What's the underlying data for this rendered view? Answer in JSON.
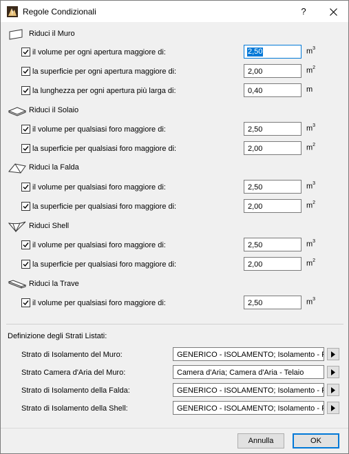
{
  "window": {
    "title": "Regole Condizionali",
    "help_label": "?",
    "close_icon": "close-icon"
  },
  "sections": {
    "muro": {
      "title": "Riduci il Muro",
      "icon": "wall-icon",
      "rows": [
        {
          "label": "il volume per ogni apertura maggiore di:",
          "value": "2,50",
          "unit": "m",
          "sup": "3",
          "checked": true
        },
        {
          "label": "la superficie per ogni apertura maggiore di:",
          "value": "2,00",
          "unit": "m",
          "sup": "2",
          "checked": true
        },
        {
          "label": "la lunghezza per ogni apertura più larga di:",
          "value": "0,40",
          "unit": "m",
          "sup": "",
          "checked": true
        }
      ]
    },
    "solaio": {
      "title": "Riduci il Solaio",
      "icon": "slab-icon",
      "rows": [
        {
          "label": "il volume per qualsiasi foro maggiore di:",
          "value": "2,50",
          "unit": "m",
          "sup": "3",
          "checked": true
        },
        {
          "label": "la superficie per qualsiasi foro maggiore di:",
          "value": "2,00",
          "unit": "m",
          "sup": "2",
          "checked": true
        }
      ]
    },
    "falda": {
      "title": "Riduci la Falda",
      "icon": "roof-icon",
      "rows": [
        {
          "label": "il volume per qualsiasi foro maggiore di:",
          "value": "2,50",
          "unit": "m",
          "sup": "3",
          "checked": true
        },
        {
          "label": "la superficie per qualsiasi foro maggiore di:",
          "value": "2,00",
          "unit": "m",
          "sup": "2",
          "checked": true
        }
      ]
    },
    "shell": {
      "title": "Riduci Shell",
      "icon": "shell-icon",
      "rows": [
        {
          "label": "il volume per qualsiasi foro maggiore di:",
          "value": "2,50",
          "unit": "m",
          "sup": "3",
          "checked": true
        },
        {
          "label": "la superficie per qualsiasi foro maggiore di:",
          "value": "2,00",
          "unit": "m",
          "sup": "2",
          "checked": true
        }
      ]
    },
    "trave": {
      "title": "Riduci la Trave",
      "icon": "beam-icon",
      "rows": [
        {
          "label": "il volume per qualsiasi foro maggiore di:",
          "value": "2,50",
          "unit": "m",
          "sup": "3",
          "checked": true
        }
      ]
    }
  },
  "definitions": {
    "title": "Definizione degli Strati Listati:",
    "rows": [
      {
        "label": "Strato di Isolamento del Muro:",
        "value": "GENERICO - ISOLAMENTO; Isolamento - F"
      },
      {
        "label": "Strato Camera d'Aria del Muro:",
        "value": "Camera d'Aria; Camera d'Aria - Telaio"
      },
      {
        "label": "Strato di Isolamento della Falda:",
        "value": "GENERICO - ISOLAMENTO; Isolamento - F"
      },
      {
        "label": "Strato di Isolamento della Shell:",
        "value": "GENERICO - ISOLAMENTO; Isolamento - F"
      }
    ]
  },
  "buttons": {
    "cancel": "Annulla",
    "ok": "OK"
  },
  "colors": {
    "focus": "#0078d7",
    "background": "#f0f0f0"
  }
}
